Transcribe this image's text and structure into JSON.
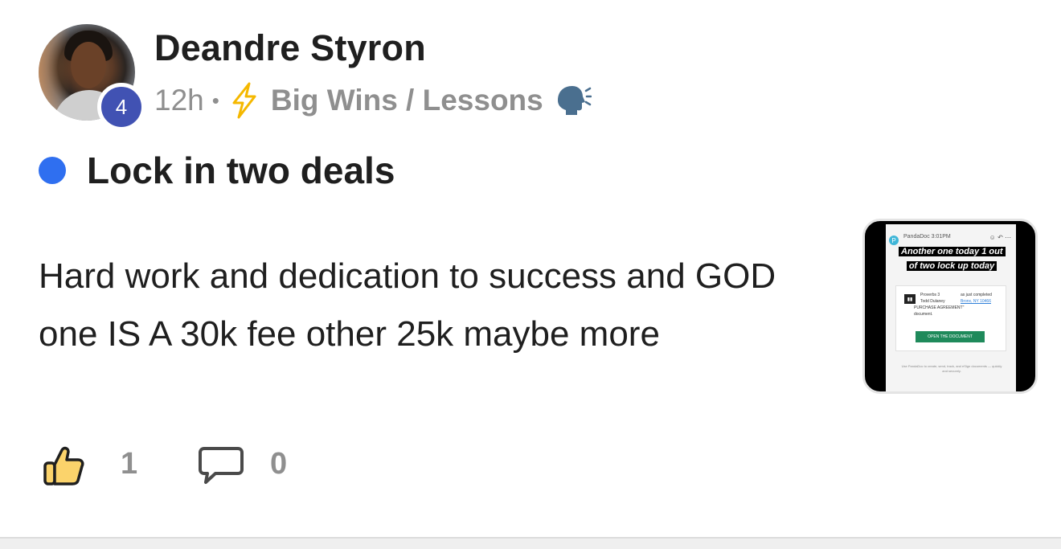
{
  "post": {
    "author": "Deandre Styron",
    "level": "4",
    "time": "12h",
    "separator": "•",
    "category": "Big Wins / Lessons",
    "title": "Lock in two deals",
    "body_line1": "Hard work and dedication to success and GOD",
    "body_line2": "one IS A 30k fee other 25k maybe more",
    "likes": "1",
    "comments": "0"
  },
  "thumbnail": {
    "app_logo": "P",
    "app_name": "PandaDoc  3:01PM",
    "caption": "Another one today 1 out of two lock up today",
    "doc_title": "Proverbs 3",
    "doc_status": "as just completed",
    "doc_sender": "Todd Dulaney",
    "doc_location": "Bronx, NY 10466",
    "doc_name": "PURCHASE AGREEMENT\"",
    "doc_word": "document.",
    "button": "OPEN THE DOCUMENT",
    "footer": "Use PandaDoc to create, send, track, and eSign documents — quickly and securely."
  },
  "colors": {
    "title_dot": "#2f6ff0",
    "level_badge": "#4152b3",
    "meta_text": "#8f8f8f",
    "bolt": "#f5b800"
  },
  "icons": {
    "category": "lightning-bolt-icon",
    "category_trailing": "speaking-head-icon",
    "like": "thumbs-up-icon",
    "comment": "comment-bubble-icon"
  }
}
